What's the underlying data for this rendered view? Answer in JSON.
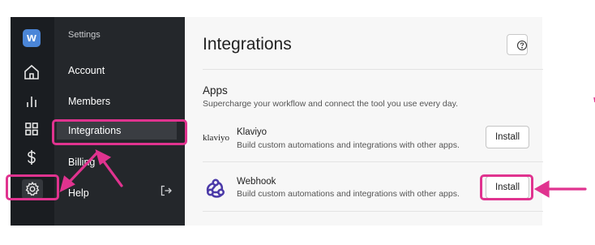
{
  "rail": {
    "logo_letter": "w",
    "icons": [
      "home-icon",
      "bar-chart-icon",
      "grid-icon",
      "dollar-icon",
      "gear-icon"
    ]
  },
  "sidebar": {
    "section_label": "Settings",
    "items": [
      {
        "label": "Account"
      },
      {
        "label": "Members"
      },
      {
        "label": "Integrations",
        "active": true
      },
      {
        "label": "Billing"
      },
      {
        "label": "Help"
      }
    ],
    "logout_icon": "logout-icon"
  },
  "main": {
    "title": "Integrations",
    "help_icon": "question-circle-icon",
    "apps_heading": "Apps",
    "apps_subtitle": "Supercharge your workflow and connect the tool you use every day.",
    "apps": [
      {
        "logo_text": "klaviyo",
        "name": "Klaviyo",
        "description": "Build custom automations and integrations with other apps.",
        "action": "Install"
      },
      {
        "logo_icon": "webhook-icon",
        "name": "Webhook",
        "description": "Build custom automations and integrations with other apps.",
        "action": "Install"
      }
    ]
  },
  "annotations": {
    "color": "#e0338f"
  }
}
